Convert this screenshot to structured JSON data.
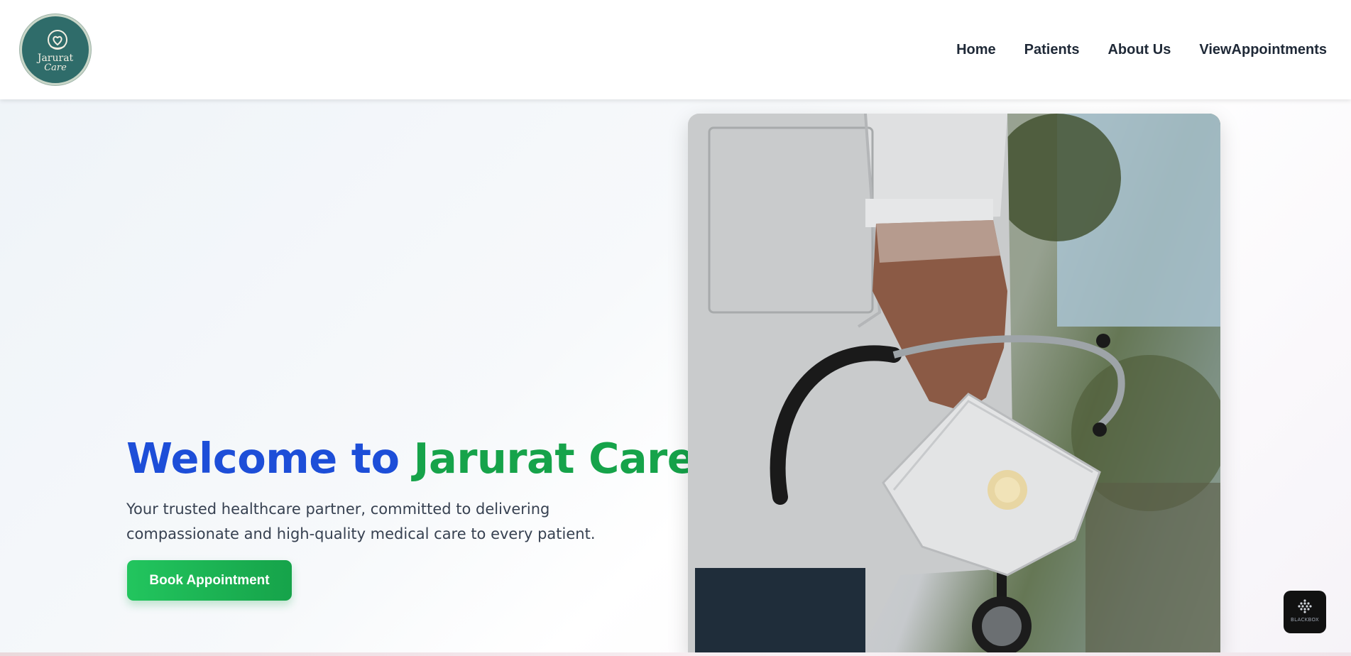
{
  "brand": {
    "logo_line1": "Jarurat",
    "logo_line2": "Care",
    "logo_icon": "heart-hand-icon"
  },
  "nav": {
    "items": [
      {
        "label": "Home"
      },
      {
        "label": "Patients"
      },
      {
        "label": "About Us"
      },
      {
        "label": "ViewAppointments"
      }
    ]
  },
  "hero": {
    "title_part1": "Welcome to",
    "title_part2": "Jarurat Care",
    "subtitle": "Your trusted healthcare partner, committed to delivering compassionate and high-quality medical care to every patient.",
    "cta_label": "Book Appointment",
    "image_subject": "doctor-holding-stethoscope-and-mask"
  },
  "badge": {
    "label": "BLACKBOX",
    "icon": "blackbox-dots-icon"
  },
  "colors": {
    "title_blue": "#1d4ed8",
    "title_green": "#16a34a",
    "cta_green": "#22c55e",
    "logo_teal": "#2f6c6a"
  }
}
